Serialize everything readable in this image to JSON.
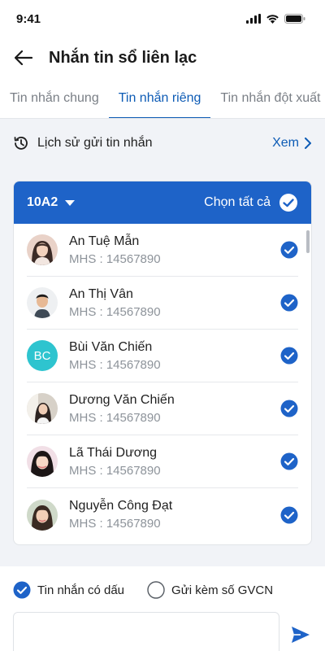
{
  "status_bar": {
    "time": "9:41"
  },
  "header": {
    "title": "Nhắn tin sổ liên lạc"
  },
  "tabs": [
    {
      "label": "Tin nhắn chung",
      "active": false
    },
    {
      "label": "Tin nhắn riêng",
      "active": true
    },
    {
      "label": "Tin nhắn đột xuất",
      "active": false
    }
  ],
  "history": {
    "label": "Lịch sử gửi tin nhắn",
    "action": "Xem"
  },
  "class_card": {
    "class_name": "10A2",
    "select_all_label": "Chọn tất cả",
    "students": [
      {
        "name": "An Tuệ Mẫn",
        "id": "MHS : 14567890",
        "avatar": "photo",
        "checked": true
      },
      {
        "name": "An Thị Vân",
        "id": "MHS : 14567890",
        "avatar": "photo",
        "checked": true
      },
      {
        "name": "Bùi Văn Chiến",
        "id": "MHS : 14567890",
        "avatar": "BC",
        "checked": true
      },
      {
        "name": "Dương Văn Chiến",
        "id": "MHS : 14567890",
        "avatar": "photo",
        "checked": true
      },
      {
        "name": "Lã Thái Dương",
        "id": "MHS : 14567890",
        "avatar": "photo",
        "checked": true
      },
      {
        "name": "Nguyễn Công Đạt",
        "id": "MHS : 14567890",
        "avatar": "photo",
        "checked": true
      }
    ]
  },
  "options": {
    "accent_label": "Tin nhắn có dấu",
    "accent_checked": true,
    "gvcn_label": "Gửi kèm số GVCN",
    "gvcn_checked": false
  },
  "compose": {
    "placeholder": ""
  },
  "colors": {
    "primary": "#1e63c8",
    "accent_text": "#0d5bb5",
    "background_gray": "#f1f3f7"
  }
}
